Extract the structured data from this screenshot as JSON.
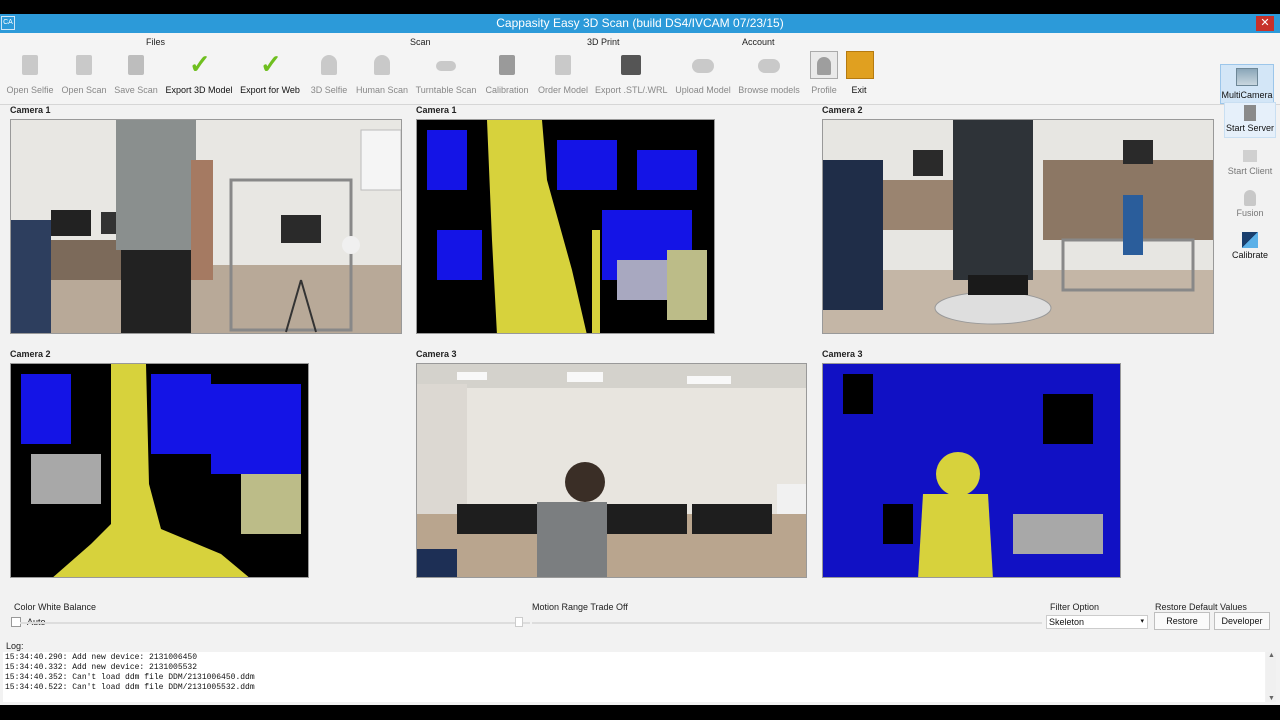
{
  "window": {
    "title": "Cappasity Easy 3D Scan (build DS4/IVCAM 07/23/15)",
    "icon_text": "CA",
    "close_glyph": "✕"
  },
  "toolbar": {
    "groups": {
      "files": "Files",
      "scan": "Scan",
      "print": "3D Print",
      "account": "Account"
    },
    "tools": {
      "open_selfie": "Open Selfie",
      "open_scan": "Open Scan",
      "save_scan": "Save Scan",
      "export_3d": "Export 3D Model",
      "export_web": "Export for Web",
      "selfie_3d": "3D Selfie",
      "human_scan": "Human Scan",
      "turntable": "Turntable Scan",
      "calibration": "Calibration",
      "order_model": "Order Model",
      "export_stl": "Export .STL/.WRL",
      "upload_model": "Upload Model",
      "browse_models": "Browse models",
      "profile": "Profile",
      "exit": "Exit"
    },
    "multicamera": "MultiCamera"
  },
  "side_panel": {
    "start_server": "Start Server",
    "start_client": "Start Client",
    "fusion": "Fusion",
    "calibrate": "Calibrate"
  },
  "cameras": {
    "c1_rgb": "Camera 1",
    "c1_depth": "Camera 1",
    "c2_rgb": "Camera 2",
    "c2_depth": "Camera 2",
    "c3_rgb": "Camera 3",
    "c3_depth": "Camera 3"
  },
  "controls": {
    "white_balance_label": "Color White Balance",
    "auto_label": "Auto",
    "motion_label": "Motion Range Trade Off",
    "filter_label": "Filter Option",
    "filter_value": "Skeleton",
    "restore_label": "Restore Default Values",
    "restore_button": "Restore",
    "developer_button": "Developer"
  },
  "log": {
    "label": "Log:",
    "lines": [
      "15:34:40.290:  Add new device: 2131006450",
      "15:34:40.332:  Add new device: 2131005532",
      "15:34:40.352: Can't load ddm file DDM/2131006450.ddm",
      "15:34:40.522: Can't load ddm file DDM/2131005532.ddm"
    ]
  },
  "colors": {
    "titlebar": "#2c9ad9",
    "depth_person": "#d7d23c",
    "depth_bg": "#1414e6",
    "check_green": "#6fbf1f"
  }
}
